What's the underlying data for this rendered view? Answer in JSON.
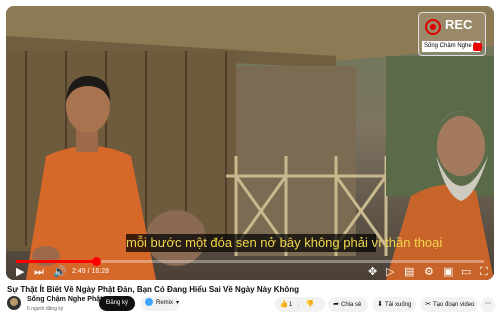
{
  "video": {
    "subtitle": "mỗi bước một đóa sen nở bây không phải vì thần thoại",
    "time_current": "2:49",
    "time_total": "16:28",
    "progress": 0.17,
    "rec_label": "REC",
    "rec_channel": "Sống Chậm Nghe Phật"
  },
  "meta": {
    "title": "Sự Thật Ít Biết Về Ngày Phật Đản, Bạn Có Đang Hiểu Sai Về Ngày Này Không",
    "channel_name": "Sống Chậm Nghe Phật",
    "subscribers": "6 người đăng ký",
    "subscribe_label": "Đăng ký",
    "remix_label": "Remix"
  },
  "actions": {
    "like_count": "1",
    "share_label": "Chia sẻ",
    "download_label": "Tải xuống",
    "clip_label": "Tạo đoạn video"
  },
  "colors": {
    "accent": "#ff0000",
    "subtitle": "#f2d64b"
  }
}
